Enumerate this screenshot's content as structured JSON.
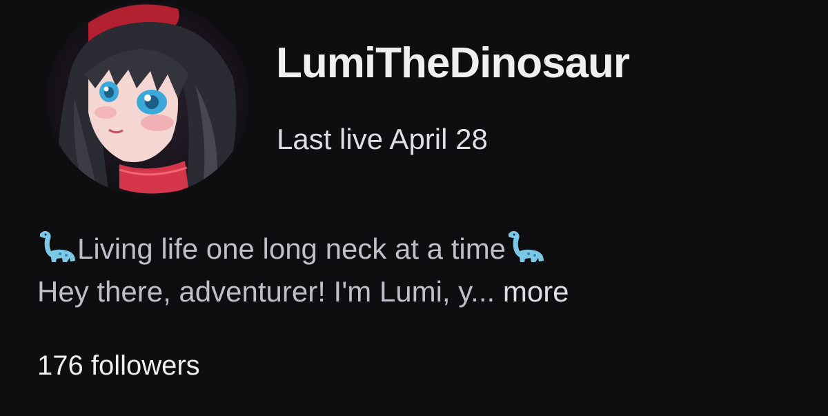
{
  "profile": {
    "name": "LumiTheDinosaur",
    "last_live": "Last live April 28",
    "avatar_icon": "avatar-portrait-icon",
    "bio_line1": "Living life one long neck at a time",
    "bio_line2_text": "Hey there, adventurer! I'm Lumi, y...",
    "more_label": "more",
    "followers": "176 followers",
    "dino_emoji_icon": "sauropod-emoji-icon"
  },
  "colors": {
    "background": "#0e0e10",
    "name": "#efeff1",
    "text": "#bfbfc7"
  }
}
